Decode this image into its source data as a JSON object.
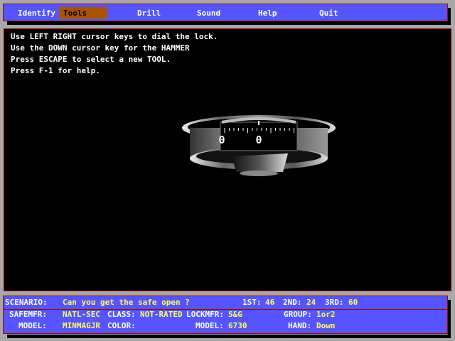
{
  "menu": {
    "items": [
      {
        "label": "Identify"
      },
      {
        "label": "Tools"
      },
      {
        "label": "Drill"
      },
      {
        "label": "Sound"
      },
      {
        "label": "Help"
      },
      {
        "label": "Quit"
      }
    ],
    "selected": "Tools"
  },
  "instructions": [
    "Use LEFT RIGHT cursor keys to dial the lock.",
    "Use the DOWN cursor key for the HAMMER",
    "Press ESCAPE to select a new TOOL.",
    "Press F-1 for help."
  ],
  "dial": {
    "number_center": "0",
    "number_left": "0"
  },
  "status": {
    "scenario_label": "SCENARIO:",
    "scenario": "Can you get the safe open ?",
    "first_label": "1ST:",
    "first": "46",
    "second_label": "2ND:",
    "second": "24",
    "third_label": "3RD:",
    "third": "60",
    "safemfr_label": "SAFEMFR:",
    "safemfr": "NATL-SEC",
    "class_label": "CLASS:",
    "class": "NOT-RATED",
    "lockmfr_label": "LOCKMFR:",
    "lockmfr": "S&G",
    "group_label": "GROUP:",
    "group": "1or2",
    "model_label": "MODEL:",
    "model": "MINMAGJR",
    "color_label": "COLOR:",
    "color": "",
    "lockmodel_label": "MODEL:",
    "lockmodel": "6730",
    "hand_label": "HAND:",
    "hand": "Down"
  },
  "colors": {
    "panel": "#5555ff",
    "border": "#a80000",
    "highlight": "#a85400",
    "value": "#ffff55",
    "background": "#a8a8a8"
  }
}
